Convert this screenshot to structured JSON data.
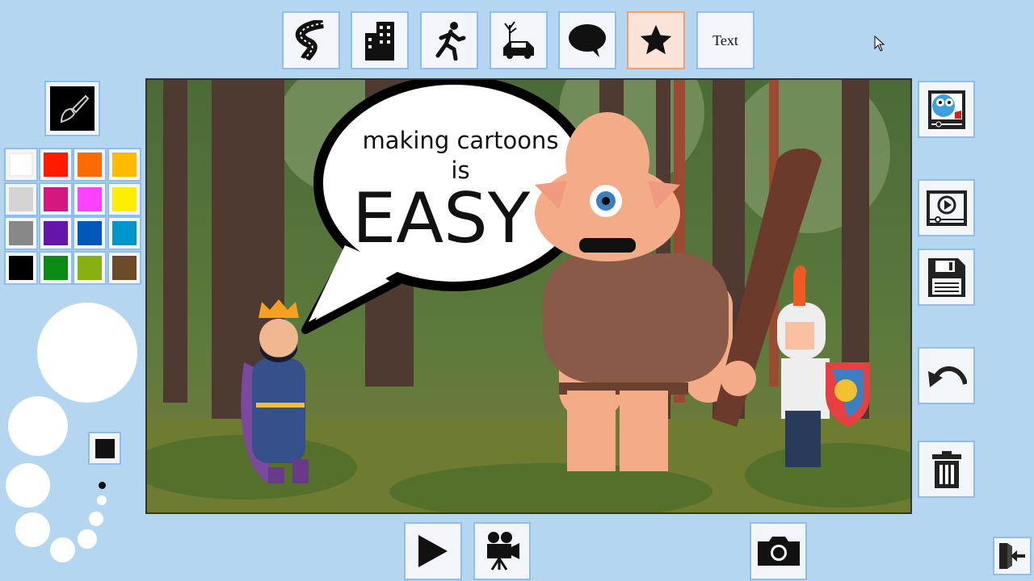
{
  "toolbar": {
    "items": [
      {
        "name": "road-icon"
      },
      {
        "name": "building-icon"
      },
      {
        "name": "running-person-icon"
      },
      {
        "name": "tree-car-icon"
      },
      {
        "name": "speech-bubble-icon"
      },
      {
        "name": "star-icon",
        "active": true
      },
      {
        "name": "text",
        "label": "Text"
      }
    ]
  },
  "palette": {
    "colors": [
      "#ffffff",
      "#ff1a00",
      "#ff6a00",
      "#ffbb00",
      "#d4d4d4",
      "#d4187f",
      "#ff40ff",
      "#ffee00",
      "#888888",
      "#6416a8",
      "#0058b8",
      "#0096cc",
      "#000000",
      "#0a8c14",
      "#88b010",
      "#6b4a28"
    ]
  },
  "brush": {
    "color": "#000000"
  },
  "scene": {
    "bubble_line1": "making cartoons",
    "bubble_line2": "is",
    "bubble_line3": "EASY"
  },
  "sidebar": {
    "items": [
      "character-gallery-icon",
      "play-movie-icon",
      "save-icon",
      "undo-icon",
      "trash-icon"
    ]
  },
  "bottom": {
    "items": [
      "play-icon",
      "movie-camera-icon",
      "camera-icon",
      "exit-icon"
    ]
  }
}
